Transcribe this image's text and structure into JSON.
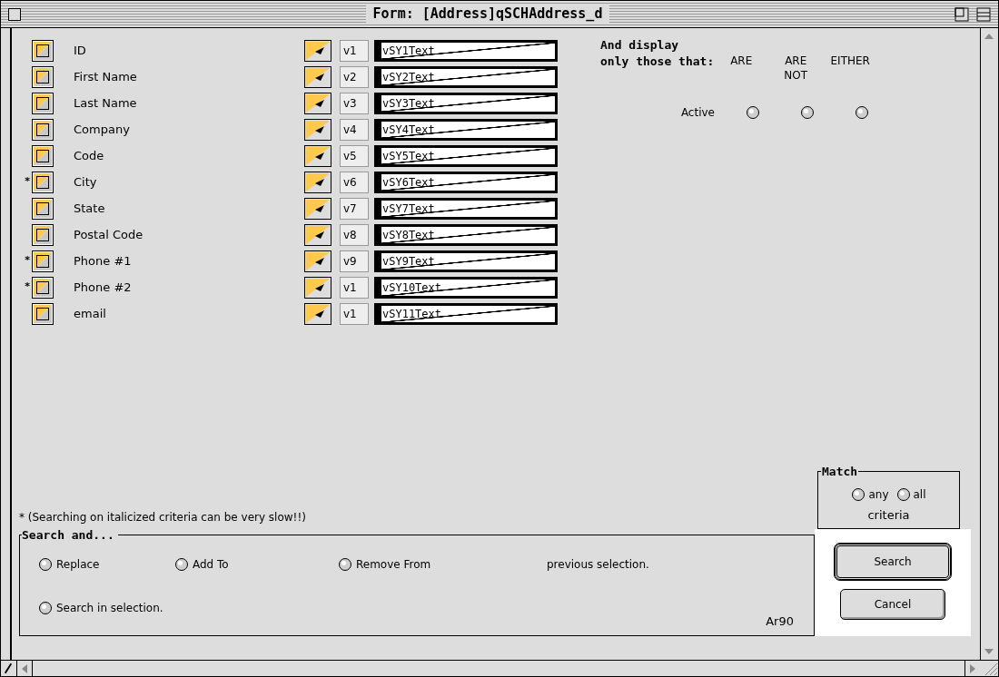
{
  "window": {
    "title": "Form: [Address]qSCHAddress_d"
  },
  "fields": [
    {
      "label": "ID",
      "checked": false,
      "index_label": "v1",
      "variable": "vSY1Text"
    },
    {
      "label": "First Name",
      "checked": false,
      "index_label": "v2",
      "variable": "vSY2Text"
    },
    {
      "label": "Last Name",
      "checked": false,
      "index_label": "v3",
      "variable": "vSY3Text"
    },
    {
      "label": "Company",
      "checked": false,
      "index_label": "v4",
      "variable": "vSY4Text"
    },
    {
      "label": "Code",
      "checked": false,
      "index_label": "v5",
      "variable": "vSY5Text"
    },
    {
      "label": "City",
      "marker": "*",
      "checked": false,
      "index_label": "v6",
      "variable": "vSY6Text"
    },
    {
      "label": "State",
      "checked": false,
      "index_label": "v7",
      "variable": "vSY7Text"
    },
    {
      "label": "Postal Code",
      "checked": false,
      "index_label": "v8",
      "variable": "vSY8Text"
    },
    {
      "label": "Phone #1",
      "marker": "*",
      "checked": false,
      "index_label": "v9",
      "variable": "vSY9Text"
    },
    {
      "label": "Phone #2",
      "marker": "*",
      "checked": false,
      "index_label": "v1",
      "variable": "vSY10Text"
    },
    {
      "label": "email",
      "checked": false,
      "index_label": "v1",
      "variable": "vSY11Text"
    }
  ],
  "display_filter": {
    "heading_lines": [
      "And display",
      "only those that:"
    ],
    "columns": [
      "ARE",
      "ARE NOT",
      "EITHER"
    ],
    "rows": [
      {
        "label": "Active",
        "options": [
          {
            "selected": false
          },
          {
            "selected": false
          },
          {
            "selected": false
          }
        ]
      }
    ]
  },
  "note": "* (Searching on italicized criteria can be very slow!!)",
  "search_mode": {
    "title": "Search and...",
    "options": [
      {
        "label": "Replace",
        "selected": false
      },
      {
        "label": "Add To",
        "selected": false
      },
      {
        "label": "Remove From",
        "selected": false
      },
      {
        "label": "Search in selection.",
        "selected": false
      }
    ],
    "suffix": "previous selection.",
    "code": "Ar90"
  },
  "match": {
    "title": "Match",
    "options": [
      {
        "label": "any",
        "selected": false
      },
      {
        "label": "all",
        "selected": false
      }
    ],
    "caption": "criteria"
  },
  "buttons": [
    {
      "label": "Search",
      "default": true
    },
    {
      "label": "Cancel",
      "default": false
    }
  ]
}
